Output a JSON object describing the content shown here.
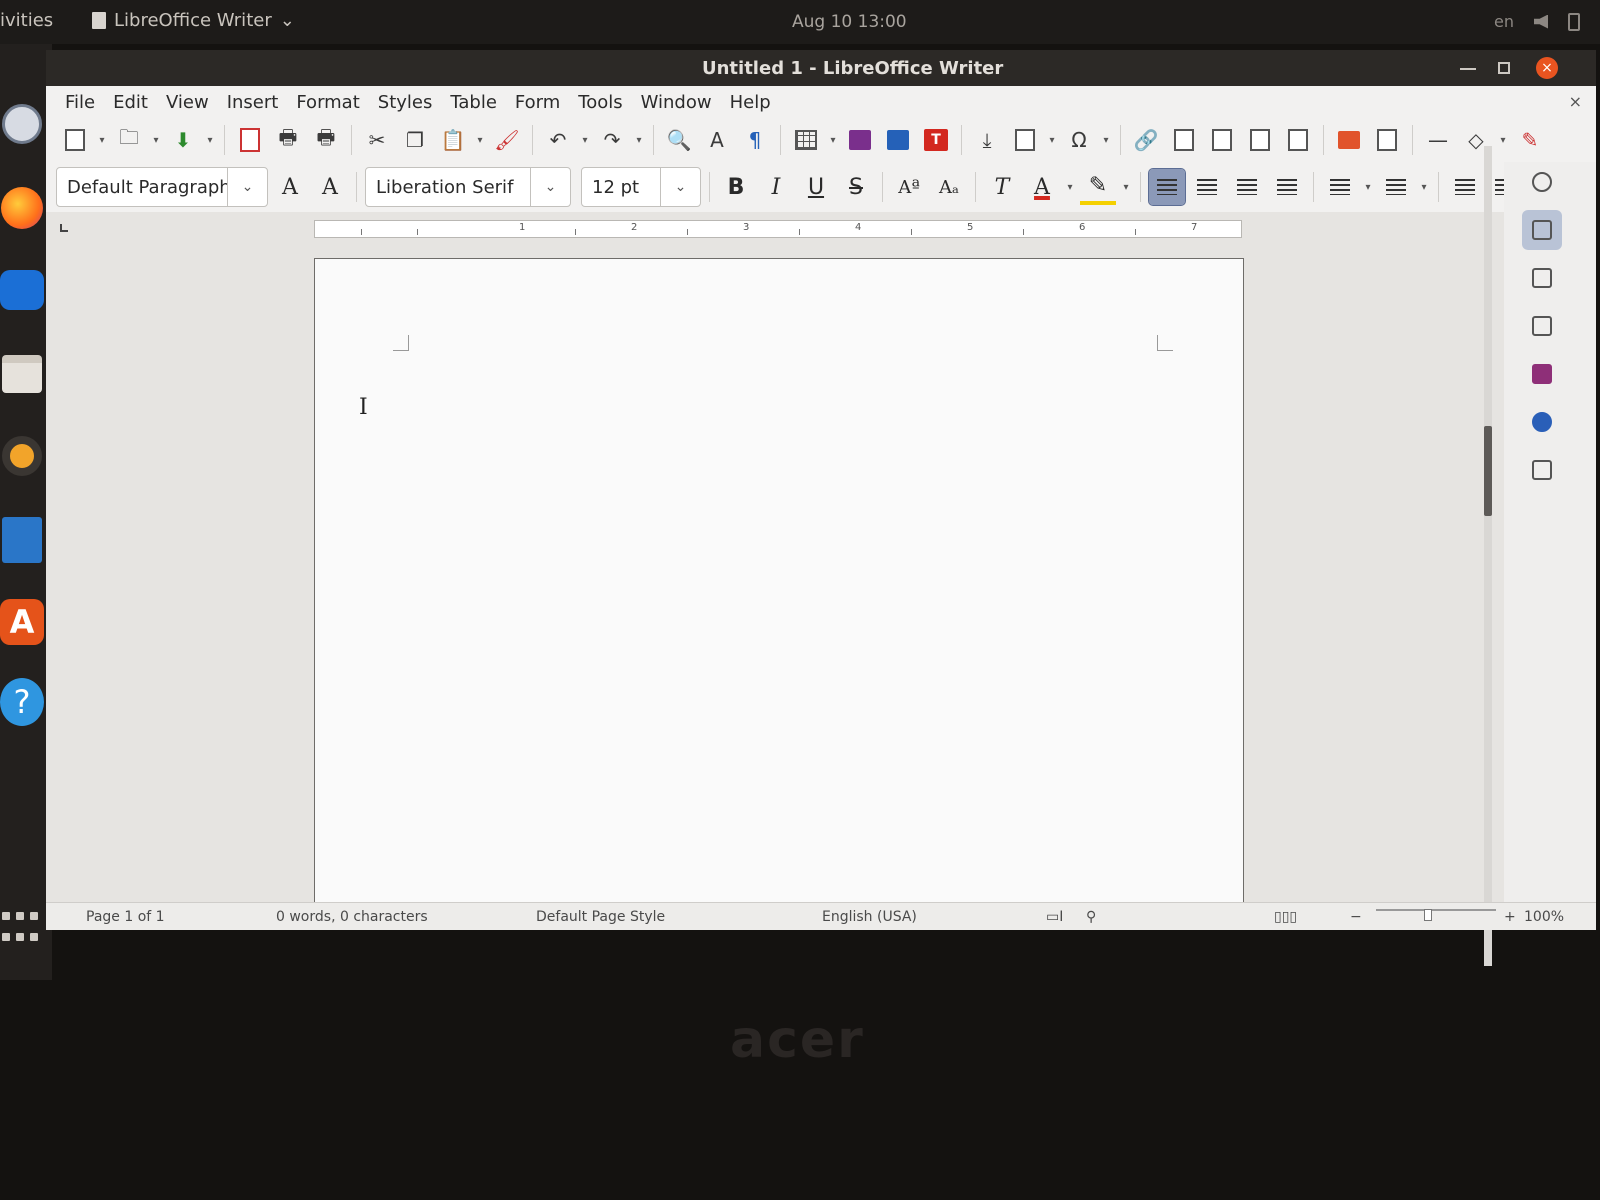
{
  "topbar": {
    "activities": "ivities",
    "app_name": "LibreOffice Writer",
    "app_menu_arrow": "⌄",
    "clock": "Aug 10  13:00",
    "keyboard_layout": "en"
  },
  "window": {
    "title": "Untitled 1 - LibreOffice Writer",
    "close_glyph": "×"
  },
  "menubar": {
    "items": [
      "File",
      "Edit",
      "View",
      "Insert",
      "Format",
      "Styles",
      "Table",
      "Form",
      "Tools",
      "Window",
      "Help"
    ],
    "doc_close": "×"
  },
  "toolbar2": {
    "paragraph_style": "Default Paragraph",
    "font_name": "Liberation Serif",
    "font_size": "12 pt",
    "bold": "B",
    "italic": "I",
    "underline": "U",
    "strikethrough": "S",
    "superscript": "Aª",
    "subscript": "Aₐ",
    "clear_formatting": "T",
    "font_color": "A",
    "highlight": "✎"
  },
  "ruler": {
    "numbers": [
      "1",
      "2",
      "3",
      "4",
      "5",
      "6",
      "7"
    ]
  },
  "document": {
    "text_cursor": "I"
  },
  "statusbar": {
    "page": "Page 1 of 1",
    "word_count": "0 words, 0 characters",
    "page_style": "Default Page Style",
    "language": "English (USA)",
    "zoom": "100%"
  },
  "dock": {
    "help_glyph": "?",
    "store_glyph": "A"
  },
  "bezel": {
    "brand": "acer"
  },
  "colors": {
    "accent_orange": "#e95420",
    "active_align": "#8b99b8",
    "font_color_red": "#d3281f",
    "highlight_yellow": "#f4d000"
  }
}
